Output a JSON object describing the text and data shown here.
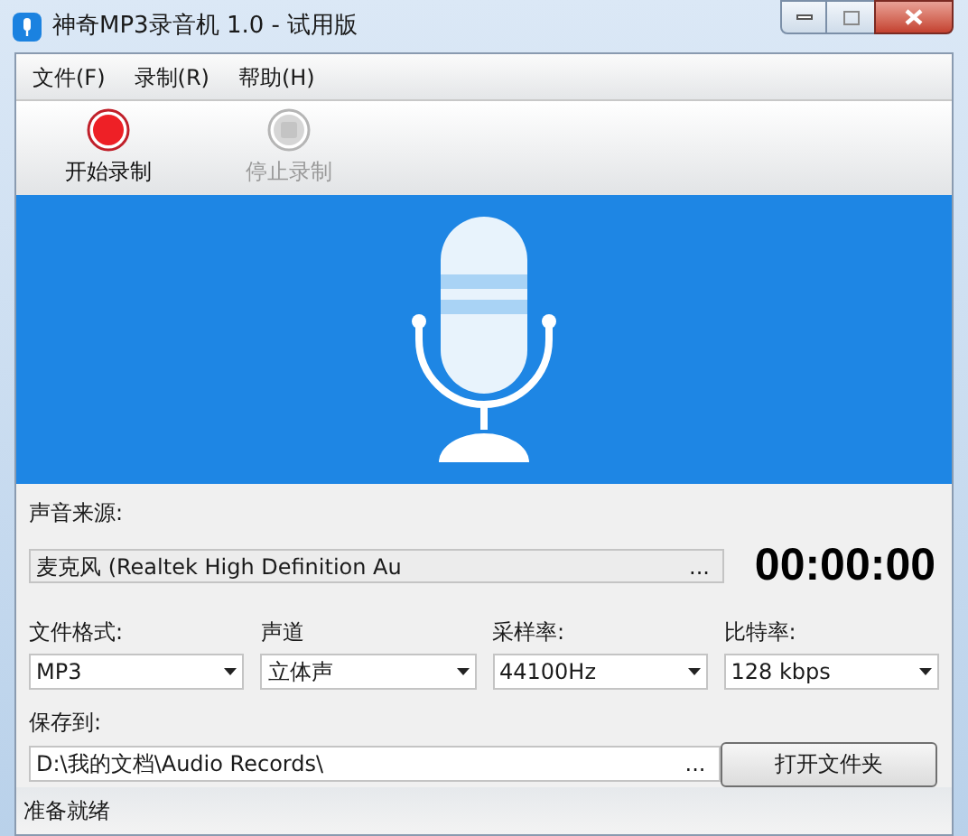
{
  "window": {
    "title": "神奇MP3录音机 1.0 - 试用版"
  },
  "menu": [
    "文件(F)",
    "录制(R)",
    "帮助(H)"
  ],
  "toolbar": [
    {
      "kind": "record",
      "label": "开始录制",
      "disabled": false
    },
    {
      "kind": "stop",
      "label": "停止录制",
      "disabled": true
    }
  ],
  "source": {
    "label": "声音来源:",
    "value": "麦克风 (Realtek High Definition Au",
    "browse": "..."
  },
  "timer": "00:00:00",
  "settings": [
    {
      "label": "文件格式:",
      "value": "MP3"
    },
    {
      "label": "声道",
      "value": "立体声"
    },
    {
      "label": "采样率:",
      "value": "44100Hz"
    },
    {
      "label": "比特率:",
      "value": "128 kbps"
    }
  ],
  "save": {
    "label": "保存到:",
    "value": "D:\\我的文档\\Audio Records\\",
    "browse": "...",
    "button": "打开文件夹"
  },
  "status_bar": "准备就绪"
}
